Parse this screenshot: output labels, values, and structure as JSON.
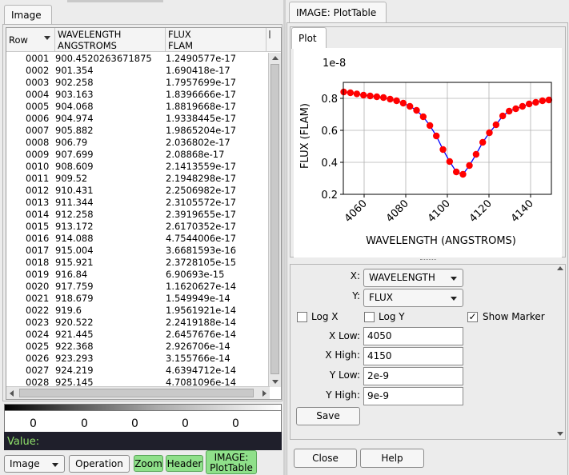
{
  "left": {
    "tab": "Image",
    "table": {
      "headers": [
        {
          "l1": "Row",
          "l2": ""
        },
        {
          "l1": "WAVELENGTH",
          "l2": "ANGSTROMS"
        },
        {
          "l1": "FLUX",
          "l2": "FLAM"
        }
      ],
      "rows": [
        [
          "0001",
          "900.4520263671875",
          "1.2490577e-17"
        ],
        [
          "0002",
          "901.354",
          "1.690418e-17"
        ],
        [
          "0003",
          "902.258",
          "1.7957699e-17"
        ],
        [
          "0004",
          "903.163",
          "1.8396666e-17"
        ],
        [
          "0005",
          "904.068",
          "1.8819668e-17"
        ],
        [
          "0006",
          "904.974",
          "1.9338445e-17"
        ],
        [
          "0007",
          "905.882",
          "1.9865204e-17"
        ],
        [
          "0008",
          "906.79",
          "2.036802e-17"
        ],
        [
          "0009",
          "907.699",
          "2.08868e-17"
        ],
        [
          "0010",
          "908.609",
          "2.1413559e-17"
        ],
        [
          "0011",
          "909.52",
          "2.1948298e-17"
        ],
        [
          "0012",
          "910.431",
          "2.2506982e-17"
        ],
        [
          "0013",
          "911.344",
          "2.3105572e-17"
        ],
        [
          "0014",
          "912.258",
          "2.3919655e-17"
        ],
        [
          "0015",
          "913.172",
          "2.6170352e-17"
        ],
        [
          "0016",
          "914.088",
          "4.7544006e-17"
        ],
        [
          "0017",
          "915.004",
          "3.6681593e-16"
        ],
        [
          "0018",
          "915.921",
          "2.3728105e-15"
        ],
        [
          "0019",
          "916.84",
          "6.90693e-15"
        ],
        [
          "0020",
          "917.759",
          "1.1620627e-14"
        ],
        [
          "0021",
          "918.679",
          "1.549949e-14"
        ],
        [
          "0022",
          "919.6",
          "1.9561921e-14"
        ],
        [
          "0023",
          "920.522",
          "2.2419188e-14"
        ],
        [
          "0024",
          "921.445",
          "2.6457676e-14"
        ],
        [
          "0025",
          "922.368",
          "2.926706e-14"
        ],
        [
          "0026",
          "923.293",
          "3.155766e-14"
        ],
        [
          "0027",
          "924.219",
          "4.6394712e-14"
        ],
        [
          "0028",
          "925.145",
          "4.7081096e-14"
        ]
      ]
    },
    "colorbar_ticks": [
      "0",
      "0",
      "0",
      "0",
      "0"
    ],
    "value_label": "Value:",
    "buttons": {
      "image_select": "Image",
      "operation": "Operation",
      "zoom": "Zoom",
      "header": "Header",
      "plottable_l1": "IMAGE:",
      "plottable_l2": "PlotTable"
    }
  },
  "right": {
    "tab": "IMAGE: PlotTable",
    "subtab": "Plot",
    "controls": {
      "x_label": "X:",
      "x_value": "WAVELENGTH",
      "y_label": "Y:",
      "y_value": "FLUX",
      "logx_label": "Log X",
      "logy_label": "Log Y",
      "show_marker_label": "Show Marker",
      "show_marker_checked": "✓",
      "xlow_label": "X Low:",
      "xlow_value": "4050",
      "xhigh_label": "X High:",
      "xhigh_value": "4150",
      "ylow_label": "Y Low:",
      "ylow_value": "2e-9",
      "yhigh_label": "Y High:",
      "yhigh_value": "9e-9",
      "save": "Save"
    },
    "close": "Close",
    "help": "Help"
  },
  "chart_data": {
    "type": "line",
    "xlabel": "WAVELENGTH (ANGSTROMS)",
    "ylabel": "FLUX (FLAM)",
    "y_scale_label": "1e-8",
    "xlim": [
      4050,
      4150
    ],
    "ylim": [
      0.2,
      0.9
    ],
    "xticks": [
      "4060",
      "4080",
      "4100",
      "4120",
      "4140"
    ],
    "xtick_values": [
      4060,
      4080,
      4100,
      4120,
      4140
    ],
    "yticks": [
      "0.2",
      "0.4",
      "0.6",
      "0.8"
    ],
    "ytick_values": [
      0.2,
      0.4,
      0.6,
      0.8
    ],
    "grid": true,
    "line_color": "#0000ff",
    "marker_color": "#ff0000",
    "x": [
      4050.2,
      4053.4,
      4056.5,
      4059.7,
      4062.9,
      4066.1,
      4069.3,
      4072.5,
      4075.6,
      4078.8,
      4082.0,
      4085.2,
      4088.4,
      4091.6,
      4094.7,
      4097.9,
      4101.1,
      4104.3,
      4107.5,
      4110.6,
      4113.8,
      4117.0,
      4120.2,
      4123.4,
      4126.6,
      4129.7,
      4132.9,
      4136.1,
      4139.3,
      4142.5,
      4145.7,
      4148.8
    ],
    "y": [
      0.84,
      0.835,
      0.828,
      0.82,
      0.815,
      0.81,
      0.805,
      0.795,
      0.785,
      0.77,
      0.75,
      0.725,
      0.685,
      0.63,
      0.565,
      0.48,
      0.405,
      0.34,
      0.325,
      0.38,
      0.45,
      0.525,
      0.585,
      0.635,
      0.69,
      0.72,
      0.735,
      0.75,
      0.765,
      0.775,
      0.785,
      0.79
    ]
  }
}
